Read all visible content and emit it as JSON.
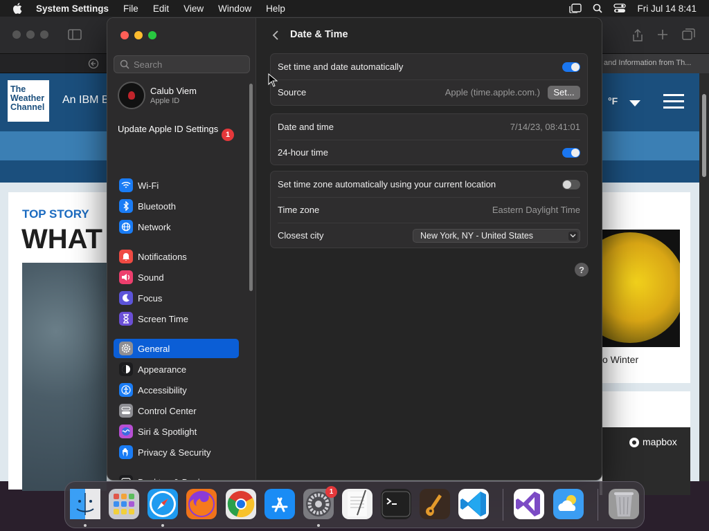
{
  "menubar": {
    "app_name": "System Settings",
    "menus": [
      "File",
      "Edit",
      "View",
      "Window",
      "Help"
    ],
    "clock": "Fri Jul 14  8:41"
  },
  "background_browser": {
    "tab_text": "and Information from Th...",
    "site": {
      "logo_lines": [
        "The",
        "Weather",
        "Channel"
      ],
      "tagline": "An IBM B",
      "unit": "°F",
      "top_story_label": "TOP STORY",
      "headline_fragment": "WHAT",
      "card_caption": "o Winter",
      "map_brand": "mapbox"
    }
  },
  "settings": {
    "search_placeholder": "Search",
    "user": {
      "name": "Calub Viem",
      "subtitle": "Apple ID"
    },
    "update": {
      "label": "Update Apple ID Settings",
      "badge": "1"
    },
    "sidebar_items": [
      {
        "label": "Wi-Fi",
        "icon": "wifi-icon",
        "color": "#1a7cf5"
      },
      {
        "label": "Bluetooth",
        "icon": "bluetooth-icon",
        "color": "#1a7cf5"
      },
      {
        "label": "Network",
        "icon": "globe-icon",
        "color": "#1a7cf5"
      },
      {
        "label": "Notifications",
        "icon": "bell-icon",
        "color": "#ef4a43"
      },
      {
        "label": "Sound",
        "icon": "speaker-icon",
        "color": "#ed3f6d"
      },
      {
        "label": "Focus",
        "icon": "moon-icon",
        "color": "#5c54d9"
      },
      {
        "label": "Screen Time",
        "icon": "hourglass-icon",
        "color": "#6b4fd6"
      },
      {
        "label": "General",
        "icon": "gear-icon",
        "color": "#8e8e93"
      },
      {
        "label": "Appearance",
        "icon": "appearance-icon",
        "color": "#1c1c1e"
      },
      {
        "label": "Accessibility",
        "icon": "accessibility-icon",
        "color": "#1a7cf5"
      },
      {
        "label": "Control Center",
        "icon": "control-center-icon",
        "color": "#8e8e93"
      },
      {
        "label": "Siri & Spotlight",
        "icon": "siri-icon",
        "color": "#b84fd3"
      },
      {
        "label": "Privacy & Security",
        "icon": "hand-icon",
        "color": "#1a7cf5"
      },
      {
        "label": "Desktop & Dock",
        "icon": "dock-icon",
        "color": "#1c1c1e"
      }
    ],
    "active_item": "General",
    "page": {
      "title": "Date & Time",
      "auto_time_label": "Set time and date automatically",
      "auto_time_on": true,
      "source_label": "Source",
      "source_value": "Apple (time.apple.com.)",
      "set_button": "Set...",
      "date_time_label": "Date and time",
      "date_time_value": "7/14/23, 08:41:01",
      "hour24_label": "24-hour time",
      "hour24_on": true,
      "auto_tz_label": "Set time zone automatically using your current location",
      "auto_tz_on": false,
      "timezone_label": "Time zone",
      "timezone_value": "Eastern Daylight Time",
      "city_label": "Closest city",
      "city_value": "New York, NY - United States",
      "help": "?"
    }
  },
  "dock": {
    "apps": [
      {
        "name": "Finder",
        "icon": "finder-icon",
        "color": "#2f8cf0",
        "running": true
      },
      {
        "name": "Launchpad",
        "icon": "launchpad-icon",
        "color": "#c9c9cf",
        "running": false
      },
      {
        "name": "Safari",
        "icon": "safari-icon",
        "color": "#1f9bf0",
        "running": true
      },
      {
        "name": "Firefox",
        "icon": "firefox-icon",
        "color": "#f0731b",
        "running": false
      },
      {
        "name": "Chrome",
        "icon": "chrome-icon",
        "color": "#e9e9e9",
        "running": false
      },
      {
        "name": "App Store",
        "icon": "app-store-icon",
        "color": "#1a8cf5",
        "running": false
      },
      {
        "name": "System Settings",
        "icon": "system-settings-icon",
        "color": "#7b7b80",
        "running": true,
        "badge": "1"
      },
      {
        "name": "TextEdit",
        "icon": "textedit-icon",
        "color": "#f2f2f2",
        "running": false
      },
      {
        "name": "Terminal",
        "icon": "terminal-icon",
        "color": "#202020",
        "running": false
      },
      {
        "name": "GarageBand",
        "icon": "garageband-icon",
        "color": "#3a2a20",
        "running": false
      },
      {
        "name": "Visual Studio Code",
        "icon": "vscode-icon",
        "color": "#ffffff",
        "running": false
      },
      {
        "name": "Visual Studio",
        "icon": "visual-studio-icon",
        "color": "#ffffff",
        "running": false
      },
      {
        "name": "Weather",
        "icon": "weather-icon",
        "color": "#3b9df2",
        "running": false
      },
      {
        "name": "Trash",
        "icon": "trash-icon",
        "color": "#9a9a9a",
        "running": false
      }
    ]
  }
}
